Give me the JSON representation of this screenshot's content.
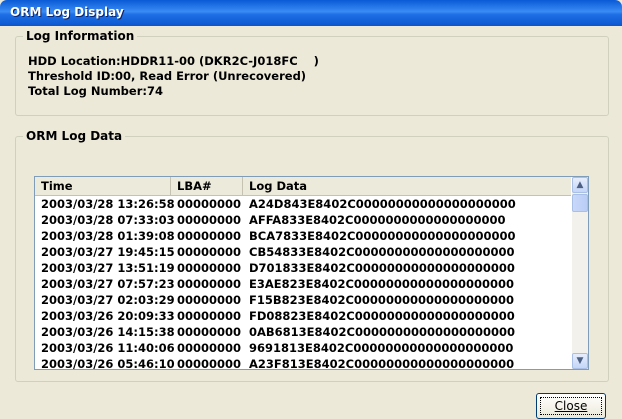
{
  "window": {
    "title": "ORM Log Display"
  },
  "log_info": {
    "group_label": "Log Information",
    "hdd_location": "HDD Location:HDDR11-00 (DKR2C-J018FC    )",
    "threshold": "Threshold ID:00, Read Error (Unrecovered)",
    "total": "Total Log Number:74"
  },
  "log_data": {
    "group_label": "ORM Log Data",
    "columns": [
      "Time",
      "LBA#",
      "Log Data"
    ],
    "rows": [
      [
        "2003/03/28 13:26:58",
        "00000000",
        "A24D843E8402C00000000000000000000"
      ],
      [
        "2003/03/28 07:33:03",
        "00000000",
        "AFFA833E8402C0000000000000000000"
      ],
      [
        "2003/03/28 01:39:08",
        "00000000",
        "BCA7833E8402C00000000000000000000"
      ],
      [
        "2003/03/27 19:45:15",
        "00000000",
        "CB54833E8402C00000000000000000000"
      ],
      [
        "2003/03/27 13:51:19",
        "00000000",
        "D701833E8402C00000000000000000000"
      ],
      [
        "2003/03/27 07:57:23",
        "00000000",
        "E3AE823E8402C00000000000000000000"
      ],
      [
        "2003/03/27 02:03:29",
        "00000000",
        "F15B823E8402C00000000000000000000"
      ],
      [
        "2003/03/26 20:09:33",
        "00000000",
        "FD08823E8402C00000000000000000000"
      ],
      [
        "2003/03/26 14:15:38",
        "00000000",
        "0AB6813E8402C00000000000000000000"
      ],
      [
        "2003/03/26 11:40:06",
        "00000000",
        "9691813E8402C00000000000000000000"
      ],
      [
        "2003/03/26 05:46:10",
        "00000000",
        "A23F813E8402C00000000000000000000"
      ]
    ]
  },
  "scrollbar": {
    "up_icon": "scroll-up-arrow",
    "down_icon": "scroll-down-arrow"
  },
  "buttons": {
    "close": "Close"
  }
}
